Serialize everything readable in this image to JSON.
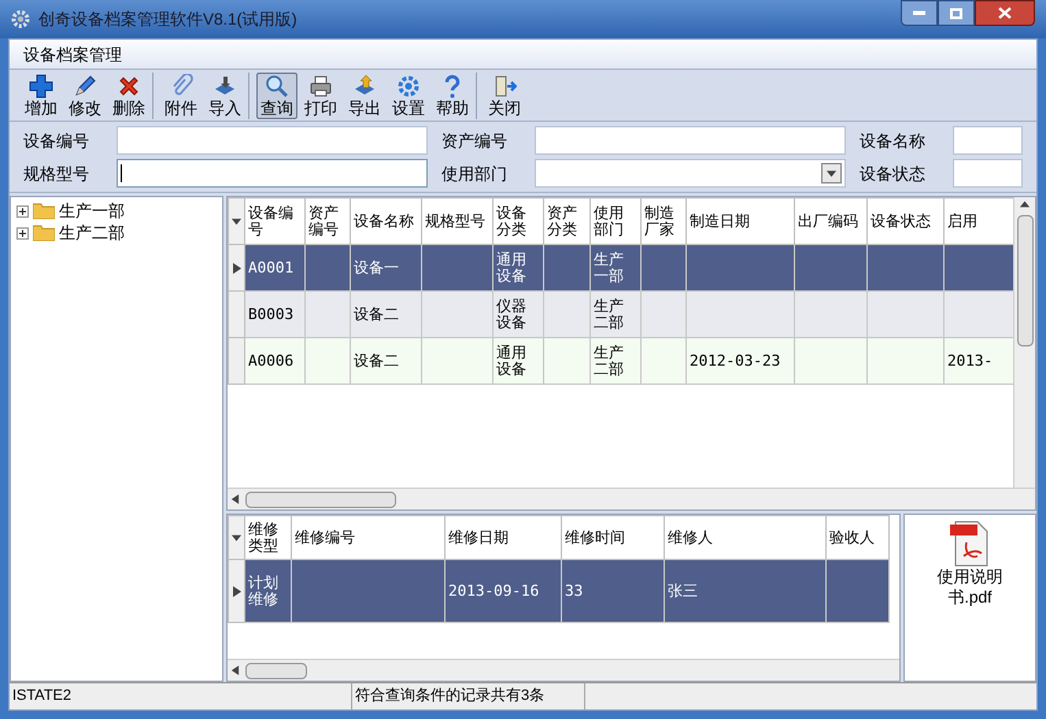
{
  "window": {
    "title": "创奇设备档案管理软件V8.1(试用版)"
  },
  "tab": {
    "label": "设备档案管理"
  },
  "toolbar": [
    [
      {
        "label": "增加",
        "selected": false
      },
      {
        "label": "修改",
        "selected": false
      },
      {
        "label": "删除",
        "selected": false
      }
    ],
    [
      {
        "label": "附件",
        "selected": false
      },
      {
        "label": "导入",
        "selected": false
      }
    ],
    [
      {
        "label": "查询",
        "selected": true
      },
      {
        "label": "打印",
        "selected": false
      },
      {
        "label": "导出",
        "selected": false
      },
      {
        "label": "设置",
        "selected": false
      },
      {
        "label": "帮助",
        "selected": false
      }
    ],
    [
      {
        "label": "关闭",
        "selected": false
      }
    ]
  ],
  "search_fields": [
    {
      "label": "设备编号",
      "kind": "input",
      "focused": false
    },
    {
      "label": "资产编号",
      "kind": "input",
      "focused": false
    },
    {
      "label": "设备名称",
      "kind": "input",
      "focused": false
    },
    {
      "label": "规格型号",
      "kind": "input",
      "focused": true
    },
    {
      "label": "使用部门",
      "kind": "select",
      "focused": false
    },
    {
      "label": "设备状态",
      "kind": "input",
      "focused": false
    }
  ],
  "tree": [
    {
      "label": "生产一部",
      "expanded": false
    },
    {
      "label": "生产二部",
      "expanded": false
    }
  ],
  "equipment_table": {
    "columns": [
      "设备编号",
      "资产编号",
      "设备名称",
      "规格型号",
      "设备分类",
      "资产分类",
      "使用部门",
      "制造厂家",
      "制造日期",
      "出厂编码",
      "设备状态",
      "启用"
    ],
    "rows": [
      {
        "selected": true,
        "cells": [
          "A0001",
          "",
          "设备一",
          "",
          "通用设备",
          "",
          "生产一部",
          "",
          "",
          "",
          "",
          ""
        ]
      },
      {
        "selected": false,
        "cells": [
          "B0003",
          "",
          "设备二",
          "",
          "仪器设备",
          "",
          "生产二部",
          "",
          "",
          "",
          "",
          ""
        ]
      },
      {
        "selected": false,
        "cells": [
          "A0006",
          "",
          "设备二",
          "",
          "通用设备",
          "",
          "生产二部",
          "",
          "2012-03-23",
          "",
          "",
          "2013-"
        ]
      }
    ]
  },
  "repair_table": {
    "columns": [
      "维修类型",
      "维修编号",
      "维修日期",
      "维修时间",
      "维修人",
      "验收人"
    ],
    "rows": [
      {
        "selected": true,
        "cells": [
          "计划维修",
          "",
          "2013-09-16",
          "33",
          "张三",
          ""
        ]
      }
    ]
  },
  "attachment": {
    "label": "使用说明书.pdf"
  },
  "status_bar": [
    "ISTATE2",
    "符合查询条件的记录共有3条"
  ]
}
